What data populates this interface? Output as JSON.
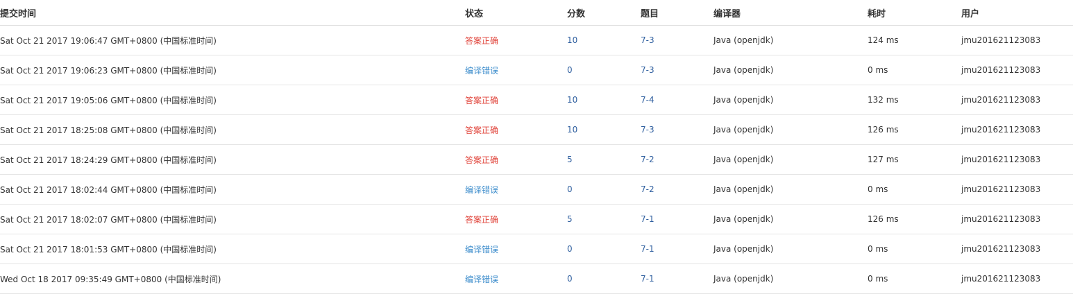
{
  "columns": {
    "submit_time": "提交时间",
    "status": "状态",
    "score": "分数",
    "problem": "题目",
    "compiler": "编译器",
    "duration": "耗时",
    "user": "用户"
  },
  "colors": {
    "accepted": "#e0433a",
    "compile_error": "#3d8dcc",
    "link": "#2f5f9f"
  },
  "rows": [
    {
      "time": "Sat Oct 21 2017 19:06:47 GMT+0800 (中国标准时间)",
      "status": "答案正确",
      "status_type": "accepted",
      "score": "10",
      "problem": "7-3",
      "compiler": "Java (openjdk)",
      "duration": "124 ms",
      "user": "jmu201621123083"
    },
    {
      "time": "Sat Oct 21 2017 19:06:23 GMT+0800 (中国标准时间)",
      "status": "编译错误",
      "status_type": "compile_error",
      "score": "0",
      "problem": "7-3",
      "compiler": "Java (openjdk)",
      "duration": "0 ms",
      "user": "jmu201621123083"
    },
    {
      "time": "Sat Oct 21 2017 19:05:06 GMT+0800 (中国标准时间)",
      "status": "答案正确",
      "status_type": "accepted",
      "score": "10",
      "problem": "7-4",
      "compiler": "Java (openjdk)",
      "duration": "132 ms",
      "user": "jmu201621123083"
    },
    {
      "time": "Sat Oct 21 2017 18:25:08 GMT+0800 (中国标准时间)",
      "status": "答案正确",
      "status_type": "accepted",
      "score": "10",
      "problem": "7-3",
      "compiler": "Java (openjdk)",
      "duration": "126 ms",
      "user": "jmu201621123083"
    },
    {
      "time": "Sat Oct 21 2017 18:24:29 GMT+0800 (中国标准时间)",
      "status": "答案正确",
      "status_type": "accepted",
      "score": "5",
      "problem": "7-2",
      "compiler": "Java (openjdk)",
      "duration": "127 ms",
      "user": "jmu201621123083"
    },
    {
      "time": "Sat Oct 21 2017 18:02:44 GMT+0800 (中国标准时间)",
      "status": "编译错误",
      "status_type": "compile_error",
      "score": "0",
      "problem": "7-2",
      "compiler": "Java (openjdk)",
      "duration": "0 ms",
      "user": "jmu201621123083"
    },
    {
      "time": "Sat Oct 21 2017 18:02:07 GMT+0800 (中国标准时间)",
      "status": "答案正确",
      "status_type": "accepted",
      "score": "5",
      "problem": "7-1",
      "compiler": "Java (openjdk)",
      "duration": "126 ms",
      "user": "jmu201621123083"
    },
    {
      "time": "Sat Oct 21 2017 18:01:53 GMT+0800 (中国标准时间)",
      "status": "编译错误",
      "status_type": "compile_error",
      "score": "0",
      "problem": "7-1",
      "compiler": "Java (openjdk)",
      "duration": "0 ms",
      "user": "jmu201621123083"
    },
    {
      "time": "Wed Oct 18 2017 09:35:49 GMT+0800 (中国标准时间)",
      "status": "编译错误",
      "status_type": "compile_error",
      "score": "0",
      "problem": "7-1",
      "compiler": "Java (openjdk)",
      "duration": "0 ms",
      "user": "jmu201621123083"
    }
  ]
}
